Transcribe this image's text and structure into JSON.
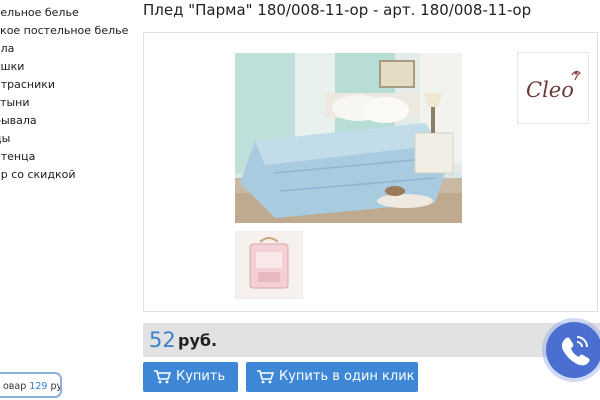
{
  "sidebar": {
    "items": [
      {
        "label": "тельное белье"
      },
      {
        "label": "ское постельное белье"
      },
      {
        "label": "яла"
      },
      {
        "label": "ушки"
      },
      {
        "label": "атрасники"
      },
      {
        "label": "стыни"
      },
      {
        "label": "рывала"
      },
      {
        "label": "ды"
      },
      {
        "label": "отенца"
      },
      {
        "label": "ар со скидкой"
      }
    ]
  },
  "cart": {
    "prefix": "овар",
    "count": "129",
    "suffix": "руб"
  },
  "product": {
    "title": "Плед \"Парма\" 180/008-11-ор - арт. 180/008-11-ор",
    "price_value": "52",
    "price_unit": "руб.",
    "brand_logo_text": "Cleo"
  },
  "buttons": {
    "buy_label": "Купить",
    "one_click_label": "Купить в один клик"
  },
  "icons": {
    "cart": "cart-icon",
    "phone": "phone-icon"
  },
  "colors": {
    "accent": "#3d87d6",
    "price": "#3b82cb",
    "price_bar": "#e2e2e2",
    "call_widget": "#4a6fd0"
  }
}
